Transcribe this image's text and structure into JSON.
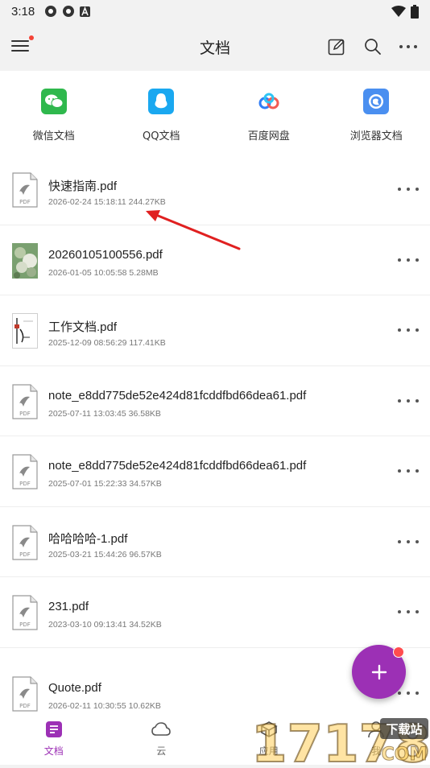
{
  "status_bar": {
    "time": "3:18"
  },
  "app_bar": {
    "title": "文档"
  },
  "shortcuts": [
    {
      "label": "微信文档",
      "icon": "wechat-icon",
      "color": "#2fb84d"
    },
    {
      "label": "QQ文档",
      "icon": "qq-icon",
      "color": "#1aa8f0"
    },
    {
      "label": "百度网盘",
      "icon": "baidu-netdisk-icon",
      "color": "#2f7df6"
    },
    {
      "label": "浏览器文档",
      "icon": "browser-icon",
      "color": "#4a8ff0"
    }
  ],
  "files": [
    {
      "name": "快速指南.pdf",
      "meta": "2026-02-24 15:18:11 244.27KB",
      "thumb": "pdf"
    },
    {
      "name": "20260105100556.pdf",
      "meta": "2026-01-05 10:05:58 5.28MB",
      "thumb": "photo"
    },
    {
      "name": "工作文档.pdf",
      "meta": "2025-12-09 08:56:29 117.41KB",
      "thumb": "doc"
    },
    {
      "name": "note_e8dd775de52e424d81fcddfbd66dea61.pdf",
      "meta": "2025-07-11 13:03:45 36.58KB",
      "thumb": "pdf"
    },
    {
      "name": "note_e8dd775de52e424d81fcddfbd66dea61.pdf",
      "meta": "2025-07-01 15:22:33 34.57KB",
      "thumb": "pdf"
    },
    {
      "name": "哈哈哈哈-1.pdf",
      "meta": "2025-03-21 15:44:26 96.57KB",
      "thumb": "pdf"
    },
    {
      "name": "231.pdf",
      "meta": "2023-03-10 09:13:41 34.52KB",
      "thumb": "pdf"
    },
    {
      "name": "Quote.pdf",
      "meta": "2026-02-11 10:30:55 10.62KB",
      "thumb": "pdf"
    }
  ],
  "pdf_thumb_label": "PDF",
  "bottom_nav": [
    {
      "label": "文档",
      "icon": "document-icon",
      "active": true
    },
    {
      "label": "云",
      "icon": "cloud-icon",
      "active": false
    },
    {
      "label": "应用",
      "icon": "apps-icon",
      "active": false
    },
    {
      "label": "我",
      "icon": "profile-icon",
      "active": false
    }
  ],
  "watermark": {
    "number": "17178",
    "text": "下载站",
    "domain": "COM"
  },
  "colors": {
    "accent": "#9c30b5",
    "badge": "#ff4d4f",
    "annotation_arrow": "#e02020"
  }
}
